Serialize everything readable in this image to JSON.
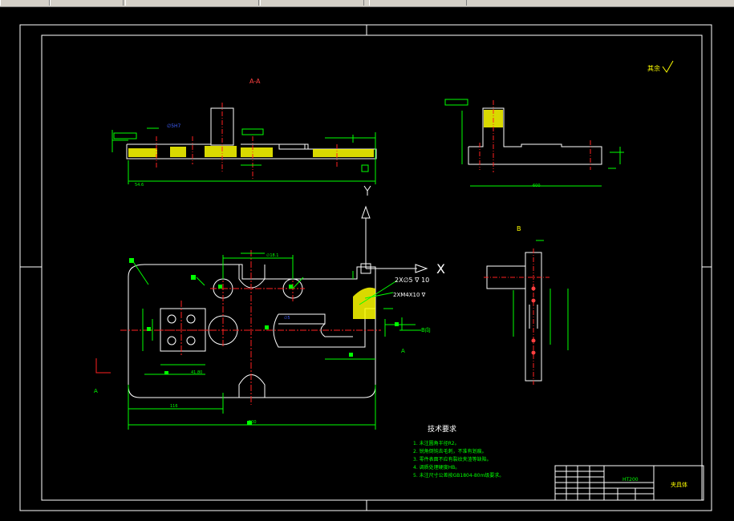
{
  "sections": {
    "section_aa": "A-A",
    "view_b": "B",
    "view_a_left": "A",
    "view_a_bottom": "A",
    "b_direction": "B向",
    "surface_finish_other": "其余"
  },
  "callouts": {
    "thread_1": "2X∅5 ∇ 10",
    "thread_2": "2XM4X10 ∇",
    "overall_length": "500",
    "dim_116": "116",
    "dim_41": "41.80",
    "top_dim": "∅18.1"
  },
  "axes": {
    "y": "Y",
    "x": "X"
  },
  "tech": {
    "title": "技术要求",
    "items": [
      "1. 未注圆角半径R2。",
      "2. 锐角倒钝去毛刺，不准有划痕。",
      "3. 零件表面不应有裂纹夹渣等缺陷。",
      "4. 调质处理硬度HB。",
      "5. 未注尺寸公差按GB1804-80m级要求。"
    ]
  },
  "title_block": {
    "material": "HT200",
    "part_name": "夹具体"
  },
  "colors": {
    "background": "#000000",
    "outline": "#ffffff",
    "dimension": "#00ff00",
    "center": "#ff2020",
    "hatch": "#ffff00",
    "axis": "#ffffff",
    "accent_blue": "#4060ff"
  }
}
